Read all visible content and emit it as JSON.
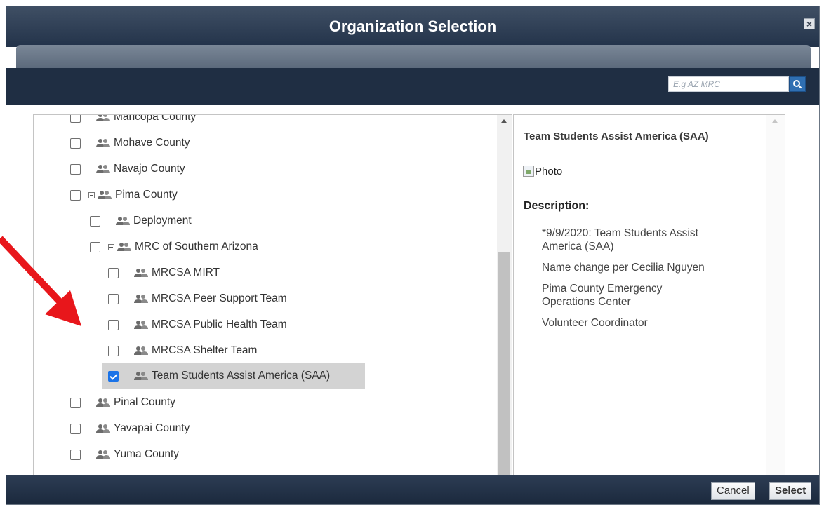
{
  "dialog": {
    "title": "Organization Selection",
    "close_label": "×"
  },
  "search": {
    "placeholder": "E.g AZ MRC",
    "icon": "search-icon"
  },
  "tree": {
    "items": [
      {
        "label": "Maricopa County",
        "checked": false
      },
      {
        "label": "Mohave County",
        "checked": false
      },
      {
        "label": "Navajo County",
        "checked": false
      },
      {
        "label": "Pima County",
        "checked": false,
        "expanded": true
      },
      {
        "label": "Deployment",
        "checked": false
      },
      {
        "label": "MRC of Southern Arizona",
        "checked": false,
        "expanded": true
      },
      {
        "label": "MRCSA MIRT",
        "checked": false
      },
      {
        "label": "MRCSA Peer Support Team",
        "checked": false
      },
      {
        "label": "MRCSA Public Health Team",
        "checked": false
      },
      {
        "label": "MRCSA Shelter Team",
        "checked": false
      },
      {
        "label": "Team Students Assist America (SAA)",
        "checked": true,
        "selected": true
      },
      {
        "label": "Pinal County",
        "checked": false
      },
      {
        "label": "Yavapai County",
        "checked": false
      },
      {
        "label": "Yuma County",
        "checked": false
      }
    ]
  },
  "detail": {
    "title": "Team Students Assist America (SAA)",
    "photo_alt": "Photo",
    "description_label": "Description:",
    "description_lines": [
      "*9/9/2020: Team Students Assist America (SAA)",
      "Name change per Cecilia Nguyen",
      "Pima County Emergency Operations Center",
      "Volunteer Coordinator"
    ]
  },
  "footer": {
    "cancel_label": "Cancel",
    "select_label": "Select"
  },
  "colors": {
    "title_bar": "#23334a",
    "checkbox_checked": "#1a73e8",
    "annotation_arrow": "#e8161b"
  }
}
